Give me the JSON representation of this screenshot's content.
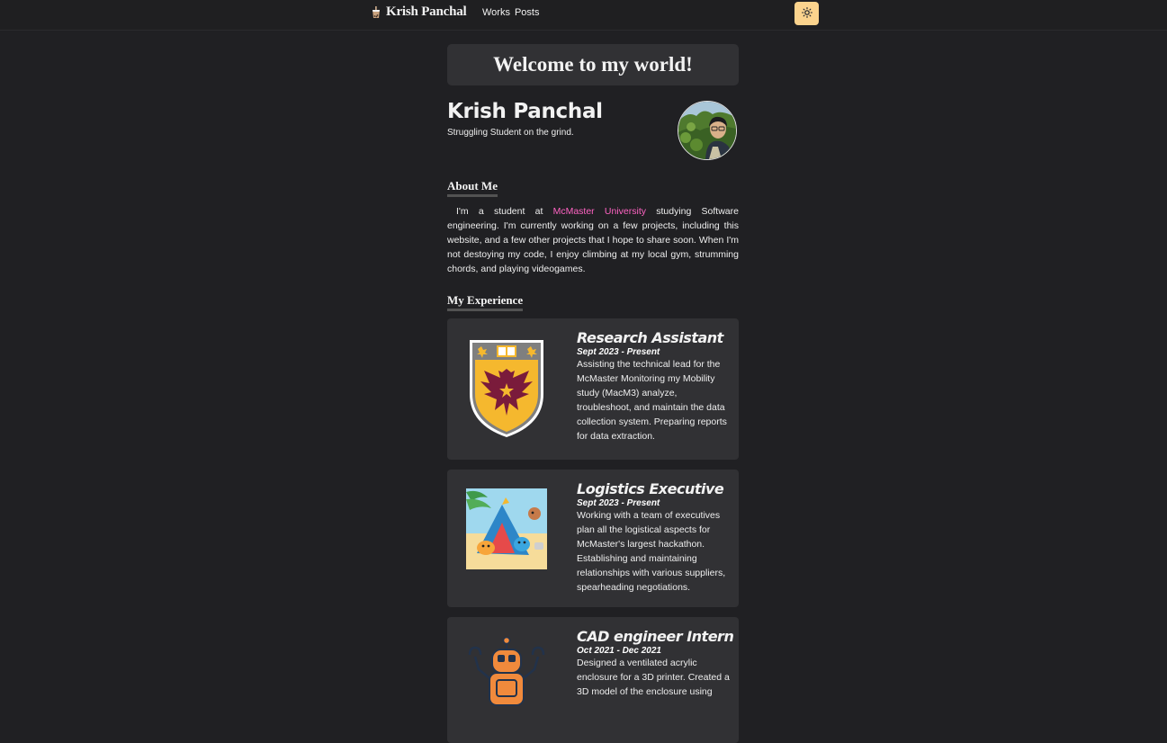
{
  "nav": {
    "brand_name": "Krish Panchal",
    "brand_icon": "bubble-tea-icon",
    "links": [
      "Works",
      "Posts"
    ],
    "theme_toggle_icon": "sun-icon",
    "toggle_color": "#fbd38d"
  },
  "welcome": "Welcome to my world!",
  "profile": {
    "name": "Krish Panchal",
    "tagline": "Struggling Student on the grind."
  },
  "about": {
    "heading": "About Me",
    "text_before": "I'm a student at ",
    "link_text": "McMaster University",
    "text_after": " studying Software engineering. I'm currently working on a few projects, including this website, and a few other projects that I hope to share soon. When I'm not destoying my code, I enjoy climbing at my local gym, strumming chords, and playing videogames.",
    "link_color": "#ff63c3"
  },
  "experience": {
    "heading": "My Experience",
    "items": [
      {
        "title": "Research Assistant",
        "date": "Sept 2023 - Present",
        "description": "Assisting the technical lead for the McMaster Monitoring my Mobility study (MacM3) analyze, troubleshoot, and maintain the data collection system. Preparing reports for data extraction.",
        "icon": "mcmaster-crest-icon"
      },
      {
        "title": "Logistics Executive",
        "date": "Sept 2023 - Present",
        "description": "Working with a team of executives plan all the logistical aspects for McMaster's largest hackathon. Establishing and maintaining relationships with various suppliers, spearheading negotiations.",
        "icon": "hackathon-tent-illustration"
      },
      {
        "title": "CAD engineer Intern",
        "date": "Oct 2021 - Dec 2021",
        "description": "Designed a ventilated acrylic enclosure for a 3D printer. Created a 3D model of the enclosure using",
        "icon": "robot-icon"
      }
    ]
  }
}
